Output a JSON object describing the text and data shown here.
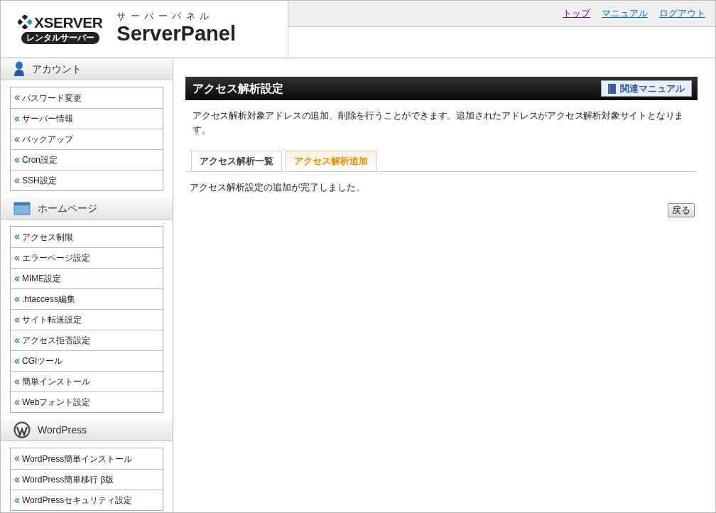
{
  "header": {
    "logo": {
      "brand": "XSERVER",
      "badge": "レンタルサーバー"
    },
    "subtitle": "サーバーパネル",
    "title": "ServerPanel",
    "links": [
      {
        "label": "トップ",
        "visited": true
      },
      {
        "label": "マニュアル",
        "visited": false
      },
      {
        "label": "ログアウト",
        "visited": false
      }
    ]
  },
  "sidebar": {
    "sections": [
      {
        "title": "アカウント",
        "items": [
          "パスワード変更",
          "サーバー情報",
          "バックアップ",
          "Cron設定",
          "SSH設定"
        ]
      },
      {
        "title": "ホームページ",
        "items": [
          "アクセス制限",
          "エラーページ設定",
          "MIME設定",
          ".htaccess編集",
          "サイト転送設定",
          "アクセス拒否設定",
          "CGIツール",
          "簡単インストール",
          "Webフォント設定"
        ]
      },
      {
        "title": "WordPress",
        "items": [
          "WordPress簡単インストール",
          "WordPress簡単移行 β版",
          "WordPressセキュリティ設定"
        ]
      }
    ]
  },
  "main": {
    "title": "アクセス解析設定",
    "manual_button": "関連マニュアル",
    "description": "アクセス解析対象アドレスの追加、削除を行うことができます。追加されたアドレスがアクセス解析対象サイトとなります。",
    "tabs": [
      {
        "label": "アクセス解析一覧",
        "selected": false
      },
      {
        "label": "アクセス解析追加",
        "selected": true
      }
    ],
    "message": "アクセス解析設定の追加が完了しました。",
    "back_button": "戻る"
  }
}
